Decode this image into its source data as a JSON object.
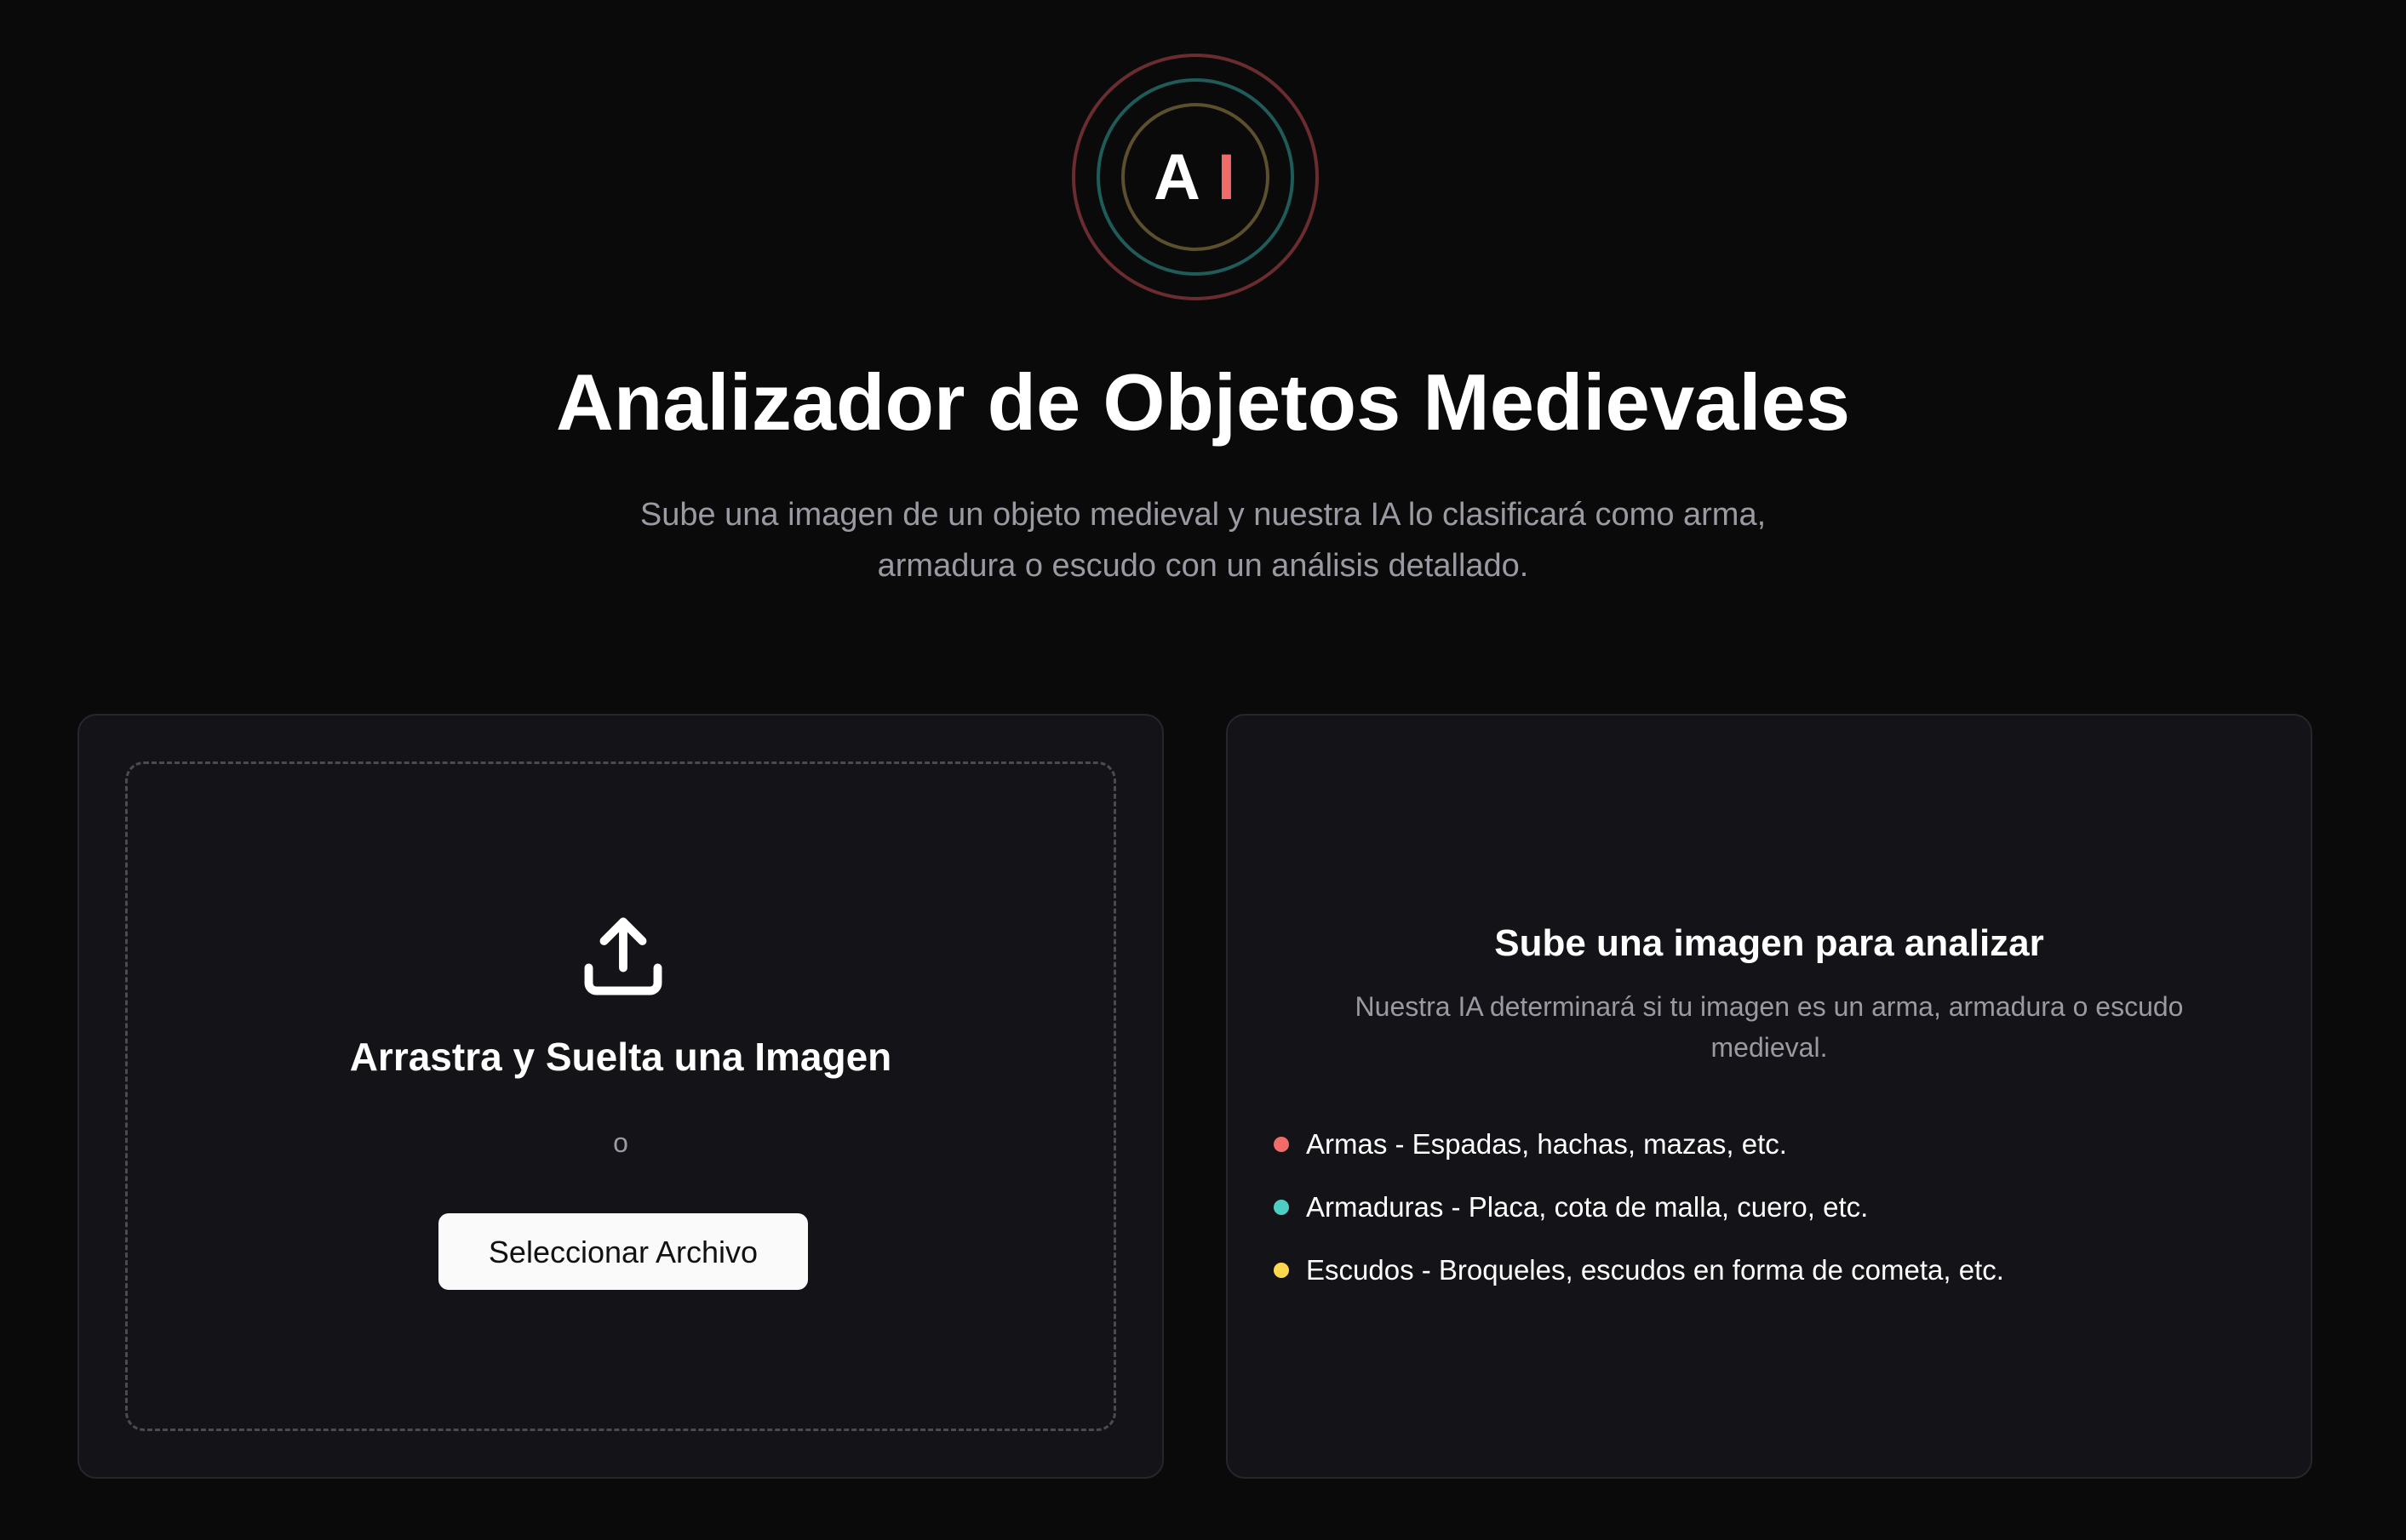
{
  "logo": {
    "letters": [
      "A",
      "I"
    ],
    "colors": {
      "outer_ring": "#6b2c30",
      "middle_ring": "#1f5b59",
      "inner_ring": "#5c4f2e",
      "accent_letter": "#f26b6b"
    }
  },
  "header": {
    "title": "Analizador de Objetos Medievales",
    "subtitle": "Sube una imagen de un objeto medieval y nuestra IA lo clasificará como arma, armadura o escudo con un análisis detallado."
  },
  "upload": {
    "icon": "upload-icon",
    "title": "Arrastra y Suelta una Imagen",
    "separator": "o",
    "button_label": "Seleccionar Archivo"
  },
  "info": {
    "title": "Sube una imagen para analizar",
    "description": "Nuestra IA determinará si tu imagen es un arma, armadura o escudo medieval.",
    "categories": [
      {
        "label": "Armas - Espadas, hachas, mazas, etc.",
        "color": "#f26b6b"
      },
      {
        "label": "Armaduras - Placa, cota de malla, cuero, etc.",
        "color": "#4ecdc4"
      },
      {
        "label": "Escudos - Broqueles, escudos en forma de cometa, etc.",
        "color": "#ffd84d"
      }
    ]
  },
  "theme": {
    "background": "#0a0a0b",
    "card_background": "#131318",
    "muted_text": "#9a9aa3"
  }
}
